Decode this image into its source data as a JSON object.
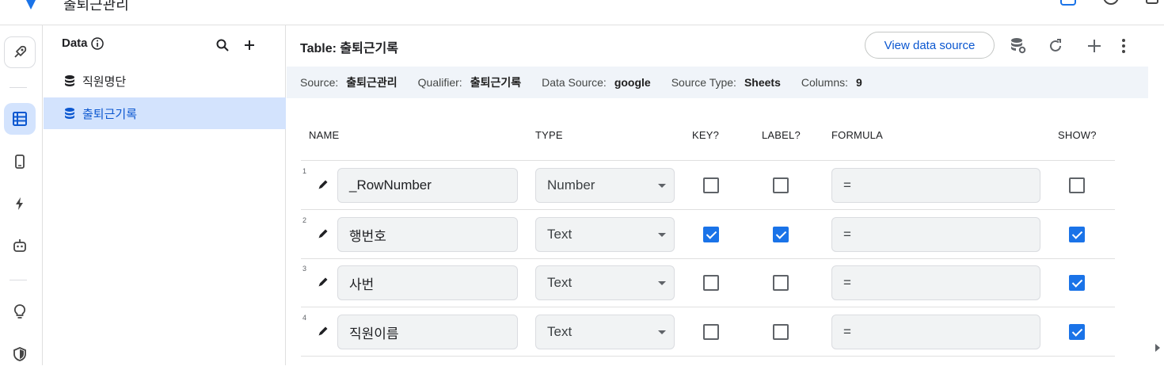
{
  "app": {
    "title": "출퇴근관리"
  },
  "panel": {
    "heading": "Data",
    "tables": [
      {
        "label": "직원명단",
        "selected": false
      },
      {
        "label": "출퇴근기록",
        "selected": true
      }
    ]
  },
  "main": {
    "title": "Table: 출퇴근기록",
    "view_source_label": "View data source",
    "info": {
      "source_label": "Source:",
      "source_value": "출퇴근관리",
      "qualifier_label": "Qualifier:",
      "qualifier_value": "출퇴근기록",
      "datasource_label": "Data Source:",
      "datasource_value": "google",
      "sourcetype_label": "Source Type:",
      "sourcetype_value": "Sheets",
      "columns_label": "Columns:",
      "columns_value": "9"
    },
    "columns": {
      "name": "NAME",
      "type": "TYPE",
      "key": "KEY?",
      "label": "LABEL?",
      "formula": "FORMULA",
      "show": "SHOW?"
    },
    "rows": [
      {
        "num": "1",
        "name": "_RowNumber",
        "type": "Number",
        "key": false,
        "label": false,
        "formula": "=",
        "show": false
      },
      {
        "num": "2",
        "name": "행번호",
        "type": "Text",
        "key": true,
        "label": true,
        "formula": "=",
        "show": true
      },
      {
        "num": "3",
        "name": "사번",
        "type": "Text",
        "key": false,
        "label": false,
        "formula": "=",
        "show": true
      },
      {
        "num": "4",
        "name": "직원이름",
        "type": "Text",
        "key": false,
        "label": false,
        "formula": "=",
        "show": true
      }
    ]
  },
  "colors": {
    "accent": "#1a73e8",
    "selected_bg": "#d3e3fd",
    "info_bg": "#f0f4f9"
  }
}
